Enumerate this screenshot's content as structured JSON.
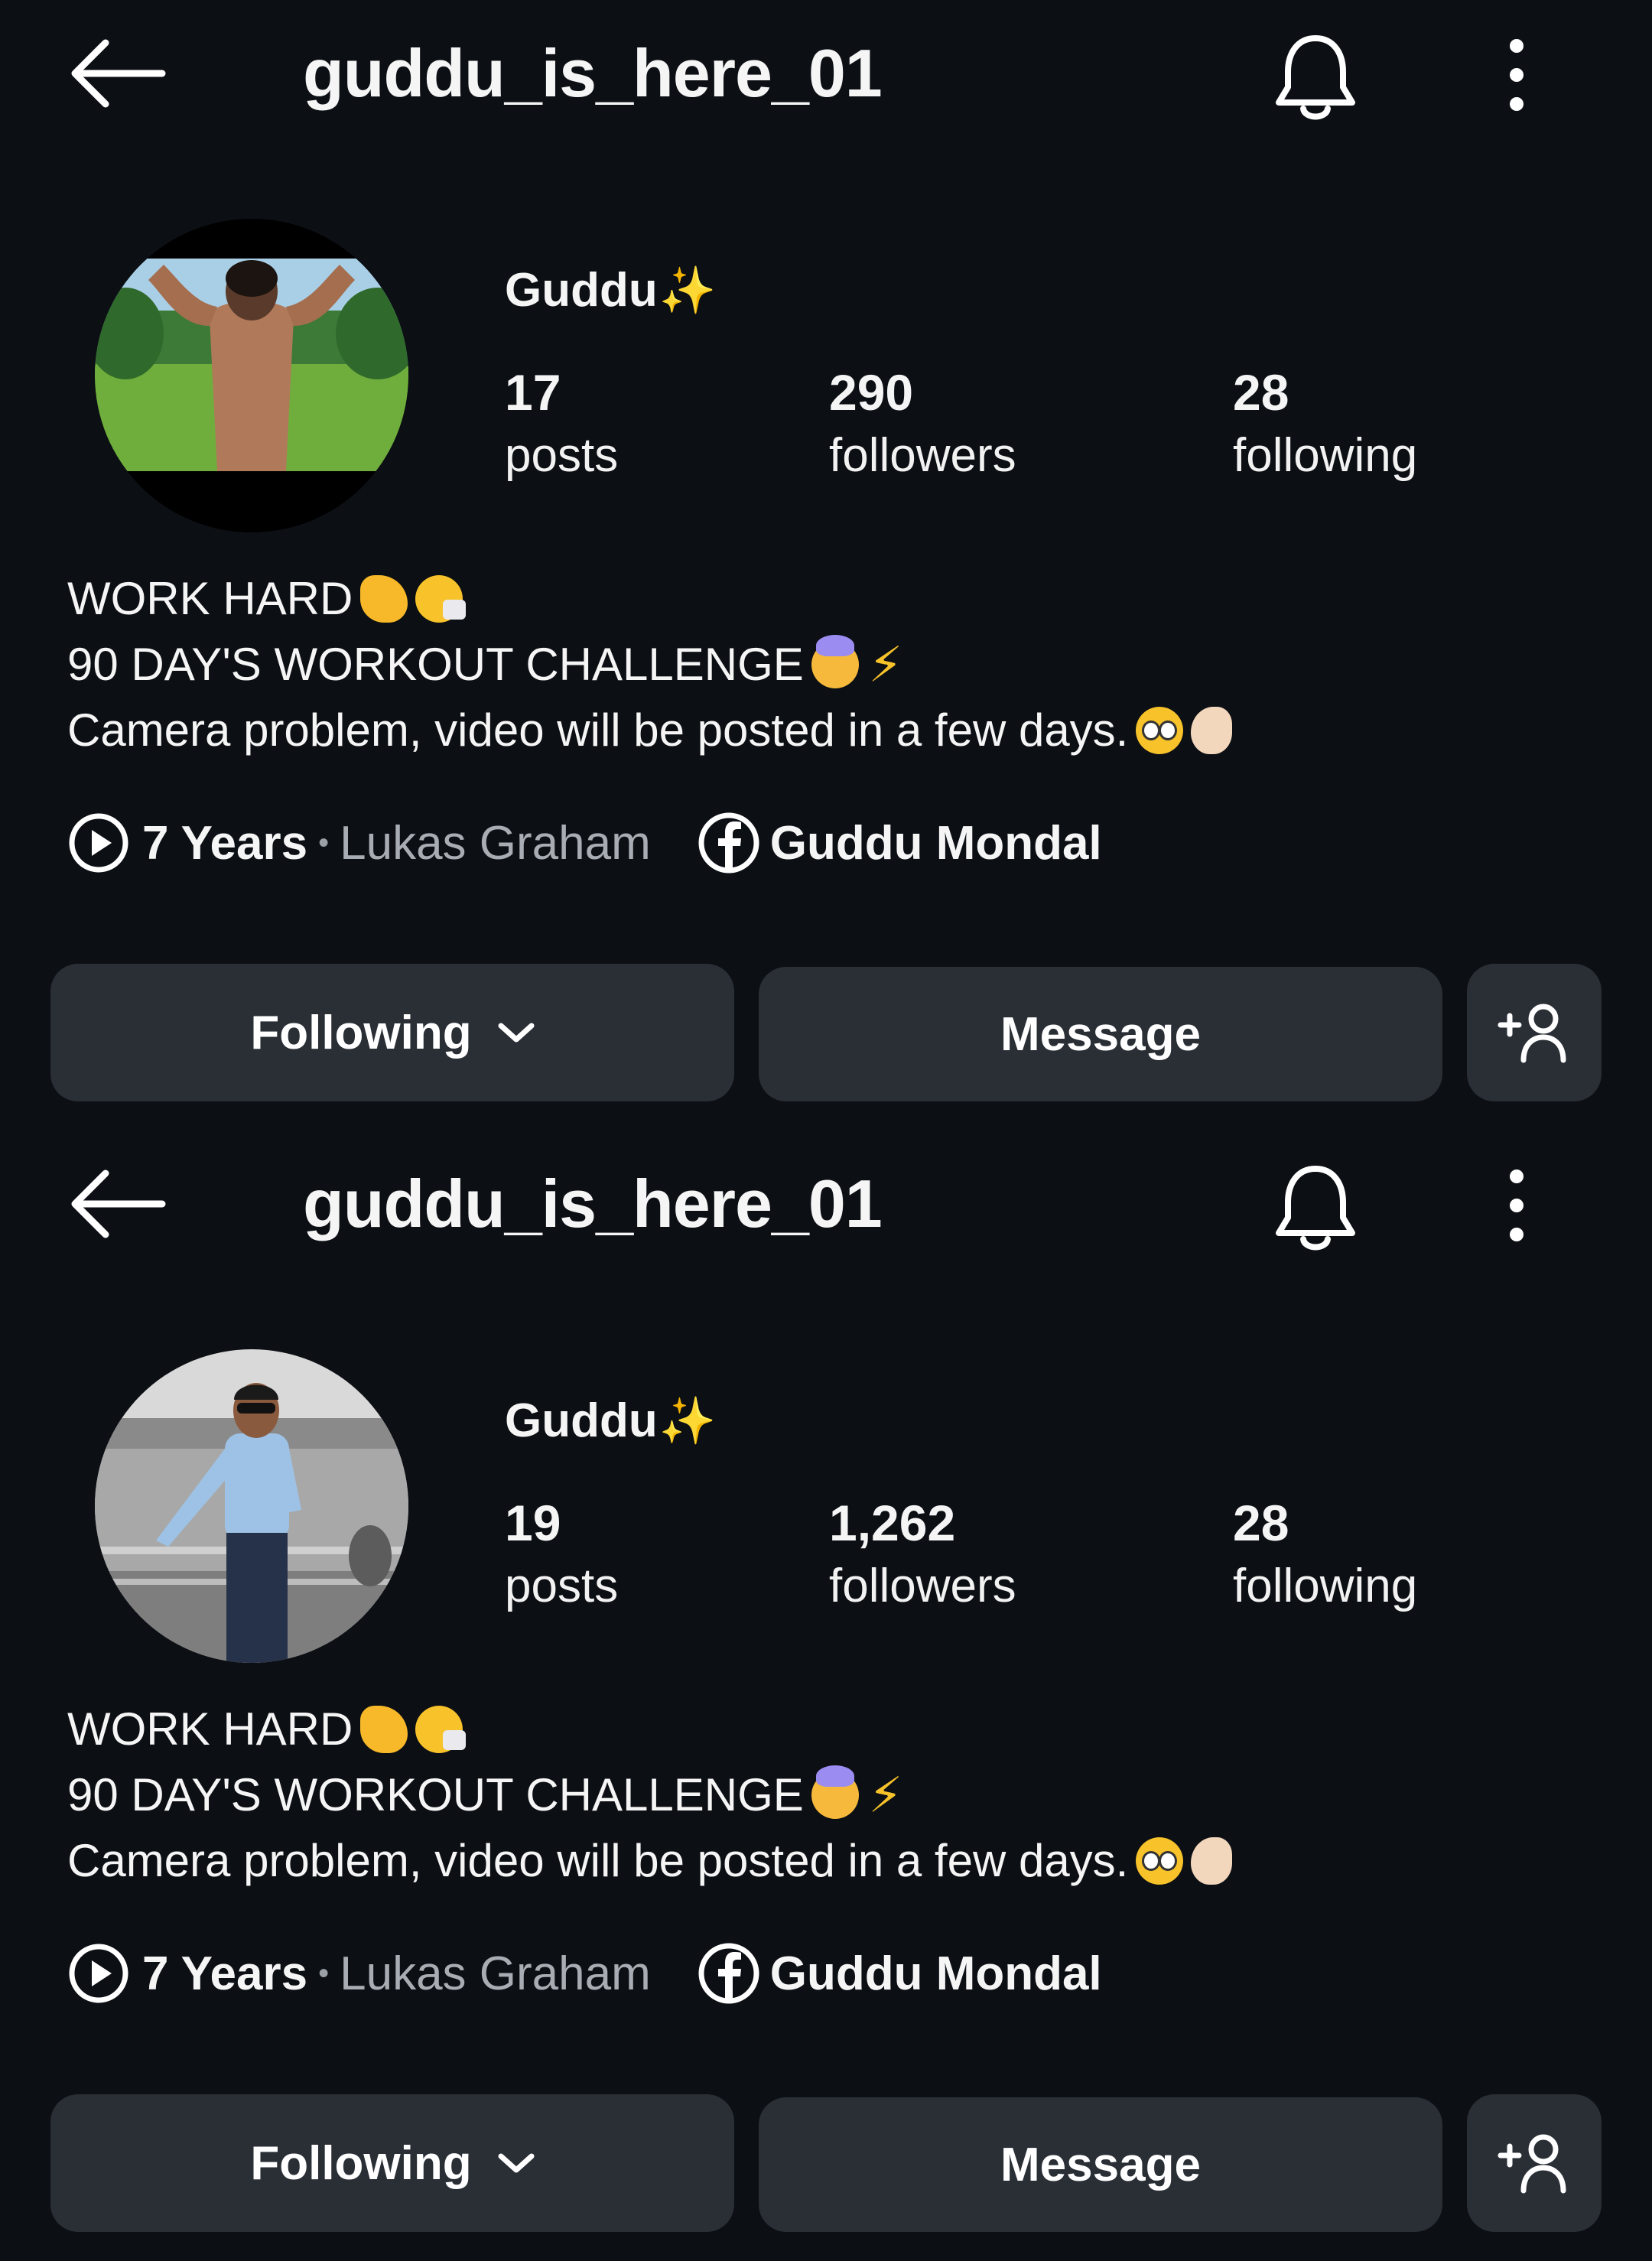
{
  "profiles": [
    {
      "username": "guddu_is_here_01",
      "display_name": "Guddu",
      "display_name_emoji": "✨",
      "stats": {
        "posts": {
          "value": "17",
          "label": "posts"
        },
        "followers": {
          "value": "290",
          "label": "followers"
        },
        "following": {
          "value": "28",
          "label": "following"
        }
      },
      "bio": [
        "WORK HARD",
        "90 DAY'S WORKOUT CHALLENGE",
        "Camera problem, video will be posted in a few days."
      ],
      "music": {
        "song": "7 Years",
        "separator": "•",
        "artist": "Lukas Graham"
      },
      "facebook_name": "Guddu Mondal",
      "buttons": {
        "following": "Following",
        "message": "Message"
      },
      "avatar": "profile-photo-flexing-back"
    },
    {
      "username": "guddu_is_here_01",
      "display_name": "Guddu",
      "display_name_emoji": "✨",
      "stats": {
        "posts": {
          "value": "19",
          "label": "posts"
        },
        "followers": {
          "value": "1,262",
          "label": "followers"
        },
        "following": {
          "value": "28",
          "label": "following"
        }
      },
      "bio": [
        "WORK HARD",
        "90 DAY'S WORKOUT CHALLENGE",
        "Camera problem, video will be posted in a few days."
      ],
      "music": {
        "song": "7 Years",
        "separator": "•",
        "artist": "Lukas Graham"
      },
      "facebook_name": "Guddu Mondal",
      "buttons": {
        "following": "Following",
        "message": "Message"
      },
      "avatar": "profile-photo-standing-by-water"
    }
  ],
  "icons": [
    "back-arrow-icon",
    "bell-icon",
    "more-options-icon",
    "play-icon",
    "facebook-icon",
    "chevron-down-icon",
    "add-user-icon"
  ],
  "colors": {
    "background": "#0c0f14",
    "button": "#2a2f36",
    "muted_text": "#a8adb3"
  }
}
